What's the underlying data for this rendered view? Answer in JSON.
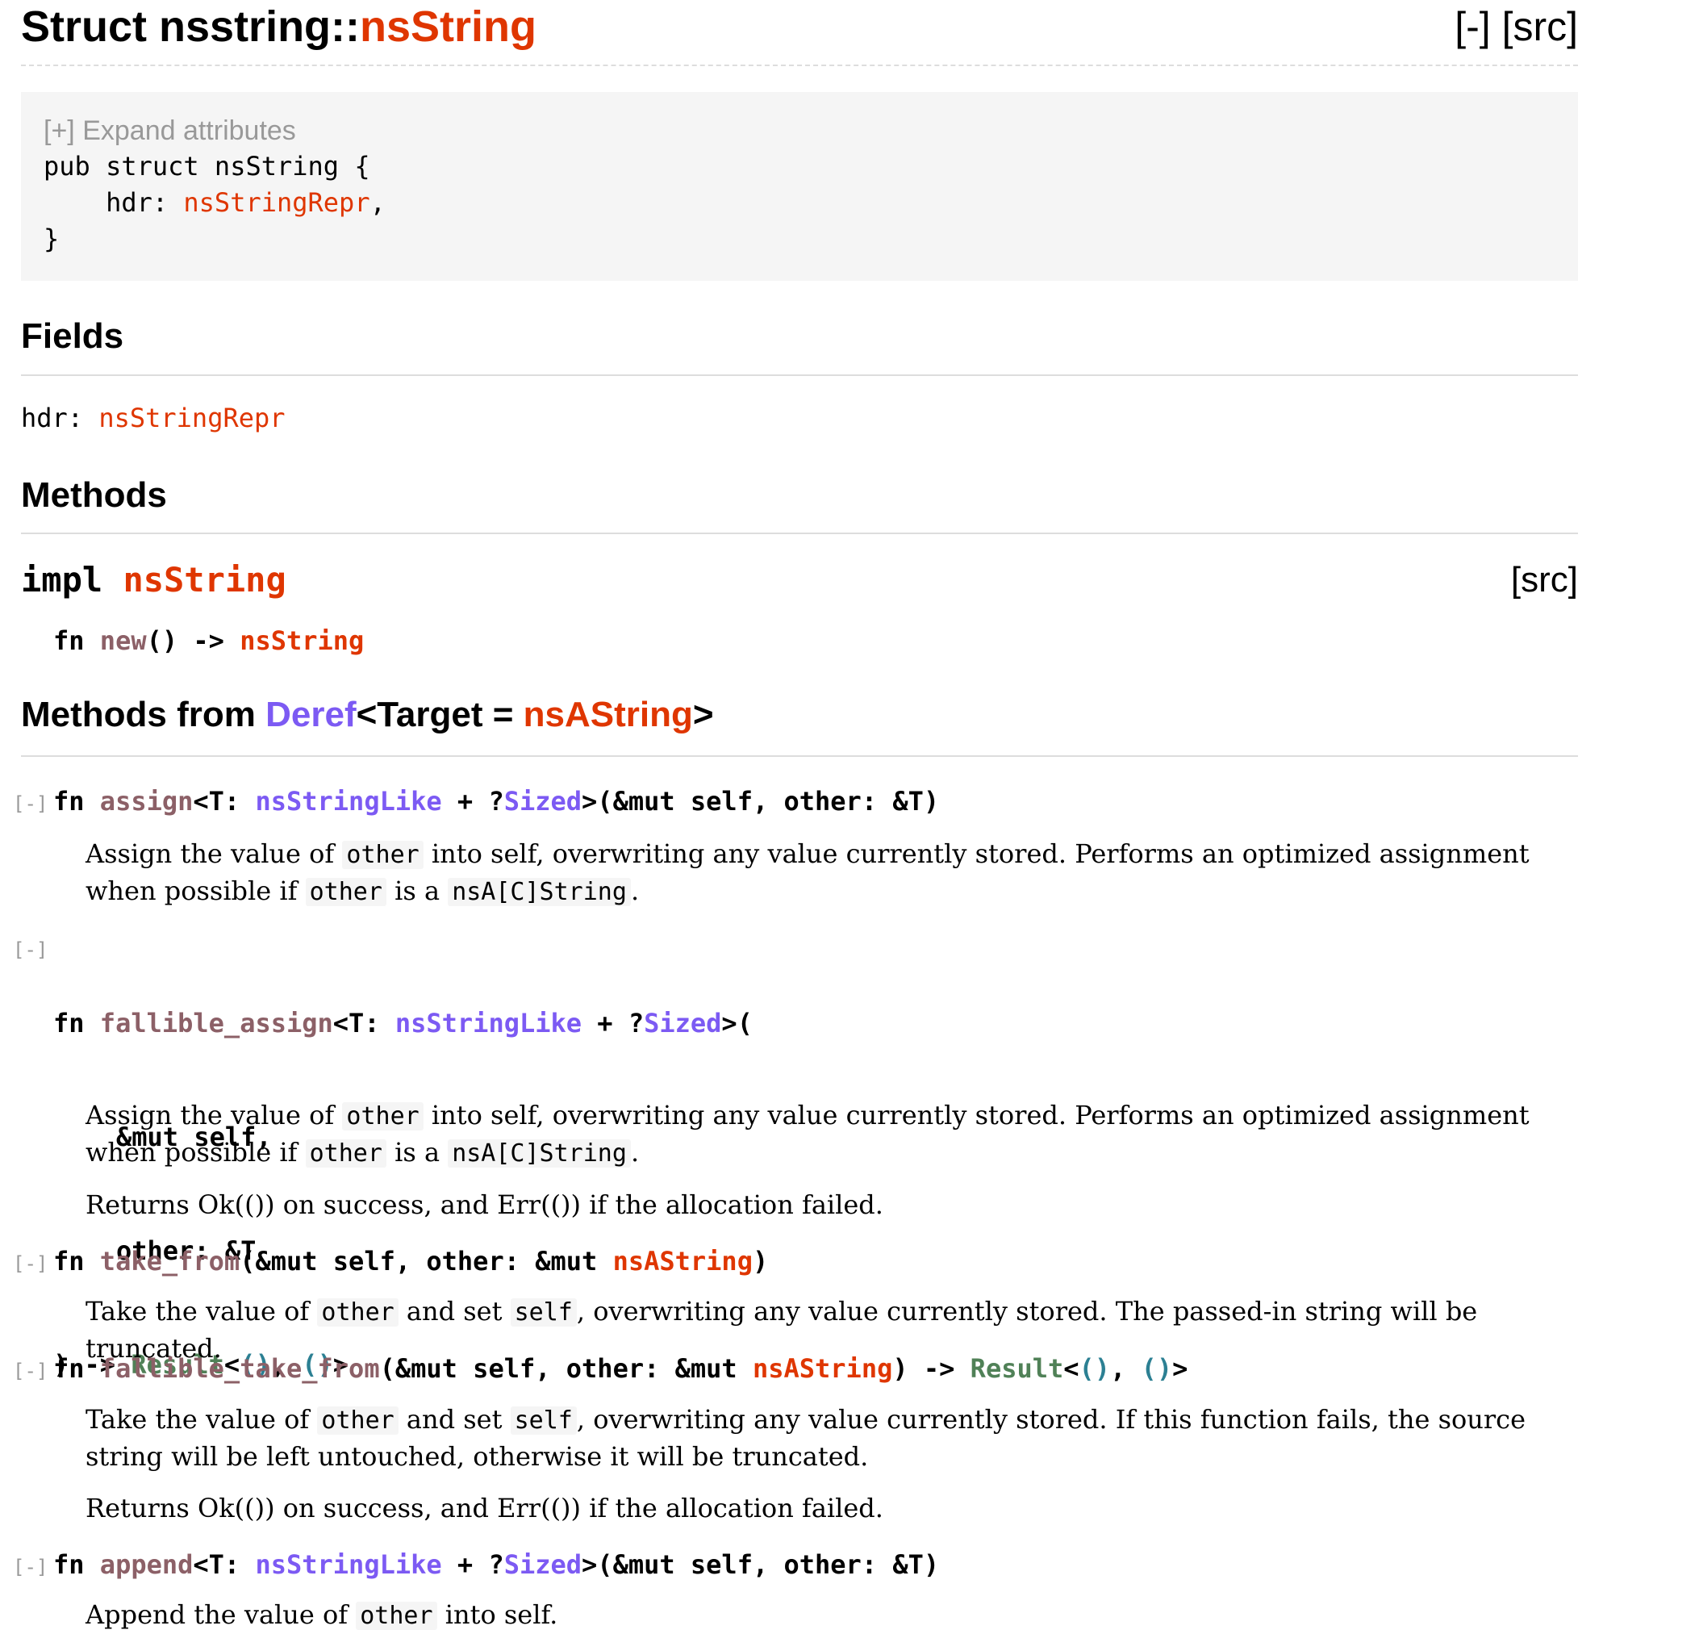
{
  "header": {
    "title_prefix": "Struct nsstring::",
    "title_name": "nsString",
    "toggle": "[-]",
    "src": "[src]"
  },
  "declaration": {
    "expand": "[+] Expand attributes",
    "line1": "pub struct nsString {",
    "field_name": "    hdr: ",
    "field_type": "nsStringRepr",
    "field_end": ",",
    "close": "}"
  },
  "fields": {
    "heading": "Fields",
    "items": [
      {
        "name": "hdr: ",
        "type": "nsStringRepr"
      }
    ]
  },
  "methods": {
    "heading": "Methods",
    "impl_kw": "impl ",
    "impl_type": "nsString",
    "impl_src": "[src]",
    "new_sig": {
      "fn": "fn ",
      "name": "new",
      "mid": "() -> ",
      "ret": "nsString"
    }
  },
  "deref": {
    "heading_prefix": "Methods from ",
    "heading_trait": "Deref",
    "heading_mid": "<Target = ",
    "heading_type": "nsAString",
    "heading_end": ">"
  },
  "items": [
    {
      "toggle": "[-]",
      "sig": {
        "fn": "fn ",
        "name": "assign",
        "a": "<T: ",
        "t1": "nsStringLike",
        "b": " + ?",
        "t2": "Sized",
        "c": ">(&mut self, other: &T)"
      },
      "doc": {
        "t1": "Assign the value of ",
        "c1": "other",
        "t2": " into self, overwriting any value currently stored. Performs an optimized assignment when possible if ",
        "c2": "other",
        "t3": " is a ",
        "c3": "nsA[C]String",
        "t4": "."
      }
    },
    {
      "toggle": "[-]",
      "sig": {
        "fn": "fn ",
        "name": "fallible_assign",
        "a": "<T: ",
        "t1": "nsStringLike",
        "b": " + ?",
        "t2": "Sized",
        "c": ">(",
        "l2": "&mut self,",
        "l3": "other: &T",
        "l4a": ") -> ",
        "res": "Result",
        "l4b": "<",
        "u1": "()",
        "l4c": ", ",
        "u2": "()",
        "l4d": ">"
      },
      "doc": {
        "t1": "Assign the value of ",
        "c1": "other",
        "t2": " into self, overwriting any value currently stored. Performs an optimized assignment when possible if ",
        "c2": "other",
        "t3": " is a ",
        "c3": "nsA[C]String",
        "t4": ".",
        "p2": "Returns Ok(()) on success, and Err(()) if the allocation failed."
      }
    },
    {
      "toggle": "[-]",
      "sig": {
        "fn": "fn ",
        "name": "take_from",
        "a": "(&mut self, other: &mut ",
        "t1": "nsAString",
        "b": ")"
      },
      "doc": {
        "t1": "Take the value of ",
        "c1": "other",
        "t2": " and set ",
        "c2": "self",
        "t3": ", overwriting any value currently stored. The passed-in string will be truncated."
      }
    },
    {
      "toggle": "[-]",
      "sig": {
        "fn": "fn ",
        "name": "fallible_take_from",
        "a": "(&mut self, other: &mut ",
        "t1": "nsAString",
        "b": ") -> ",
        "res": "Result",
        "c": "<",
        "u1": "()",
        "d": ", ",
        "u2": "()",
        "e": ">"
      },
      "doc": {
        "t1": "Take the value of ",
        "c1": "other",
        "t2": " and set ",
        "c2": "self",
        "t3": ", overwriting any value currently stored. If this function fails, the source string will be left untouched, otherwise it will be truncated.",
        "p2": "Returns Ok(()) on success, and Err(()) if the allocation failed."
      }
    },
    {
      "toggle": "[-]",
      "sig": {
        "fn": "fn ",
        "name": "append",
        "a": "<T: ",
        "t1": "nsStringLike",
        "b": " + ?",
        "t2": "Sized",
        "c": ">(&mut self, other: &T)"
      },
      "doc": {
        "t1": "Append the value of ",
        "c1": "other",
        "t2": " into self."
      }
    }
  ],
  "colors": {
    "type": "#df3600",
    "trait": "#7c5af3",
    "enum": "#508157",
    "primitive": "#2c8093",
    "method": "#9a6e31"
  }
}
